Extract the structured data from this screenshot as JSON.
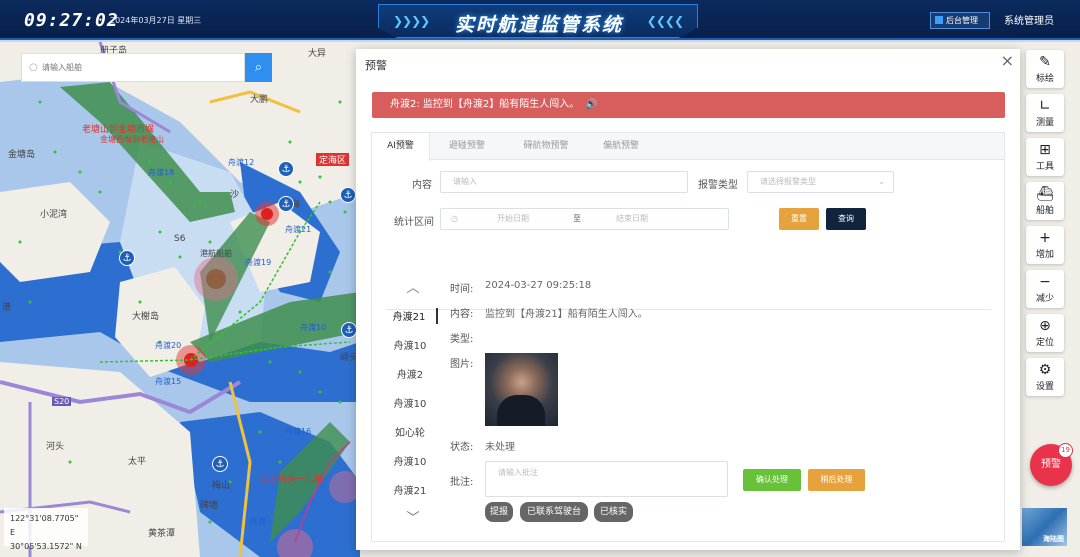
{
  "header": {
    "clock": "09:27:02",
    "date": "2024年03月27日 星期三",
    "title": "实时航道监管系统",
    "chevrons_left": "❯❯❯❯",
    "chevrons_right": "❮❮❮❮",
    "admin_button": "后台管理",
    "user": "系统管理员"
  },
  "map": {
    "search": {
      "placeholder": "请输入船舶",
      "search_icon": "search-icon"
    },
    "places": {
      "p1": "册子岛",
      "p2": "大鹏",
      "p3": "大异",
      "p4": "定海区",
      "p5": "金塘岛",
      "p6": "小泥湾",
      "p7": "大榭岛",
      "p8": "港",
      "p9": "峙头",
      "p10": "河头",
      "p11": "太平",
      "p12": "梅山",
      "p13": "碑墙",
      "p14": "黄茶潭",
      "p15": "S20",
      "p16": "老塘山到金塘西堠",
      "p17": "金塘西堠到老塘山",
      "p18": "北仑码头一六横",
      "p19": "定海",
      "p20": "舟渡12",
      "p21": "舟渡21",
      "p22": "舟渡20",
      "p23": "舟渡16",
      "p24": "舟渡18",
      "p25": "舟渡15",
      "p26": "港航船舶",
      "p27": "沙",
      "p28": "S6",
      "p29": "舟渡19",
      "p30": "舟渡10",
      "p31": "舟渡"
    },
    "coords": {
      "lon": "122°31'08.7705\" E",
      "lat": "30°05'53.1572\" N",
      "extra": "5"
    },
    "toolbar": [
      {
        "label": "标绘",
        "icon": "plot-icon",
        "glyph": "✎"
      },
      {
        "label": "测量",
        "icon": "ruler-icon",
        "glyph": "∟"
      },
      {
        "label": "工具",
        "icon": "toolbox-icon",
        "glyph": "⊞"
      },
      {
        "label": "船舶",
        "icon": "ship-icon",
        "glyph": "⛴"
      },
      {
        "label": "增加",
        "icon": "plus-icon",
        "glyph": "+"
      },
      {
        "label": "减少",
        "icon": "minus-icon",
        "glyph": "−"
      },
      {
        "label": "定位",
        "icon": "locate-icon",
        "glyph": "⊕"
      },
      {
        "label": "设置",
        "icon": "gear-icon",
        "glyph": "⚙"
      }
    ],
    "alarm_button": "预警",
    "alarm_count": "19",
    "seachart_label": "海陆图"
  },
  "modal": {
    "title": "预警",
    "close_glyph": "×",
    "banner": "舟渡2:  监控到【舟渡2】船有陌生人闯入。",
    "banner_icon": "speaker-icon",
    "tabs": [
      "AI预警",
      "避碰预警",
      "碍航物预警",
      "偏航预警"
    ],
    "filters": {
      "content_label": "内容",
      "content_placeholder": "请输入",
      "type_label": "报警类型",
      "type_placeholder": "请选择报警类型",
      "range_label": "统计区间",
      "start_placeholder": "开始日期",
      "range_sep": "至",
      "end_placeholder": "结束日期",
      "reset_button": "重置",
      "query_button": "查询"
    },
    "ships": [
      "舟渡21",
      "舟渡10",
      "舟渡2",
      "舟渡10",
      "如心轮",
      "舟渡10",
      "舟渡21"
    ],
    "detail": {
      "time_label": "时间:",
      "time_value": "2024-03-27 09:25:18",
      "content_label": "内容:",
      "content_value": "监控到【舟渡21】船有陌生人闯入。",
      "type_label": "类型:",
      "image_label": "图片:",
      "status_label": "状态:",
      "status_value": "未处理",
      "note_label": "批注:",
      "note_placeholder": "请输入批注",
      "confirm_button": "确认处理",
      "later_button": "稍后处理",
      "chips": [
        "提报",
        "已联系驾驶台",
        "已核实"
      ]
    }
  }
}
